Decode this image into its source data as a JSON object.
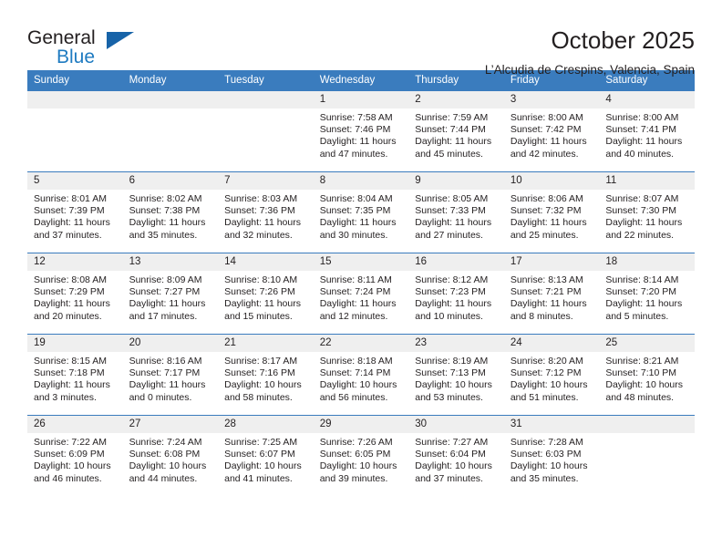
{
  "brand": {
    "name_part1": "General",
    "name_part2": "Blue",
    "accent_color": "#1763a8",
    "text_color": "#231f20"
  },
  "header": {
    "month_title": "October 2025",
    "location": "L’Alcudia de Crespins, Valencia, Spain"
  },
  "calendar": {
    "header_bg": "#3a7cbe",
    "daynum_bg": "#efefef",
    "weekday_headers": [
      "Sunday",
      "Monday",
      "Tuesday",
      "Wednesday",
      "Thursday",
      "Friday",
      "Saturday"
    ],
    "weeks": [
      [
        {
          "day": "",
          "empty": true,
          "sunrise": "",
          "sunset": "",
          "daylight_line1": "",
          "daylight_line2": ""
        },
        {
          "day": "",
          "empty": true,
          "sunrise": "",
          "sunset": "",
          "daylight_line1": "",
          "daylight_line2": ""
        },
        {
          "day": "",
          "empty": true,
          "sunrise": "",
          "sunset": "",
          "daylight_line1": "",
          "daylight_line2": ""
        },
        {
          "day": "1",
          "empty": false,
          "sunrise": "Sunrise: 7:58 AM",
          "sunset": "Sunset: 7:46 PM",
          "daylight_line1": "Daylight: 11 hours",
          "daylight_line2": "and 47 minutes."
        },
        {
          "day": "2",
          "empty": false,
          "sunrise": "Sunrise: 7:59 AM",
          "sunset": "Sunset: 7:44 PM",
          "daylight_line1": "Daylight: 11 hours",
          "daylight_line2": "and 45 minutes."
        },
        {
          "day": "3",
          "empty": false,
          "sunrise": "Sunrise: 8:00 AM",
          "sunset": "Sunset: 7:42 PM",
          "daylight_line1": "Daylight: 11 hours",
          "daylight_line2": "and 42 minutes."
        },
        {
          "day": "4",
          "empty": false,
          "sunrise": "Sunrise: 8:00 AM",
          "sunset": "Sunset: 7:41 PM",
          "daylight_line1": "Daylight: 11 hours",
          "daylight_line2": "and 40 minutes."
        }
      ],
      [
        {
          "day": "5",
          "empty": false,
          "sunrise": "Sunrise: 8:01 AM",
          "sunset": "Sunset: 7:39 PM",
          "daylight_line1": "Daylight: 11 hours",
          "daylight_line2": "and 37 minutes."
        },
        {
          "day": "6",
          "empty": false,
          "sunrise": "Sunrise: 8:02 AM",
          "sunset": "Sunset: 7:38 PM",
          "daylight_line1": "Daylight: 11 hours",
          "daylight_line2": "and 35 minutes."
        },
        {
          "day": "7",
          "empty": false,
          "sunrise": "Sunrise: 8:03 AM",
          "sunset": "Sunset: 7:36 PM",
          "daylight_line1": "Daylight: 11 hours",
          "daylight_line2": "and 32 minutes."
        },
        {
          "day": "8",
          "empty": false,
          "sunrise": "Sunrise: 8:04 AM",
          "sunset": "Sunset: 7:35 PM",
          "daylight_line1": "Daylight: 11 hours",
          "daylight_line2": "and 30 minutes."
        },
        {
          "day": "9",
          "empty": false,
          "sunrise": "Sunrise: 8:05 AM",
          "sunset": "Sunset: 7:33 PM",
          "daylight_line1": "Daylight: 11 hours",
          "daylight_line2": "and 27 minutes."
        },
        {
          "day": "10",
          "empty": false,
          "sunrise": "Sunrise: 8:06 AM",
          "sunset": "Sunset: 7:32 PM",
          "daylight_line1": "Daylight: 11 hours",
          "daylight_line2": "and 25 minutes."
        },
        {
          "day": "11",
          "empty": false,
          "sunrise": "Sunrise: 8:07 AM",
          "sunset": "Sunset: 7:30 PM",
          "daylight_line1": "Daylight: 11 hours",
          "daylight_line2": "and 22 minutes."
        }
      ],
      [
        {
          "day": "12",
          "empty": false,
          "sunrise": "Sunrise: 8:08 AM",
          "sunset": "Sunset: 7:29 PM",
          "daylight_line1": "Daylight: 11 hours",
          "daylight_line2": "and 20 minutes."
        },
        {
          "day": "13",
          "empty": false,
          "sunrise": "Sunrise: 8:09 AM",
          "sunset": "Sunset: 7:27 PM",
          "daylight_line1": "Daylight: 11 hours",
          "daylight_line2": "and 17 minutes."
        },
        {
          "day": "14",
          "empty": false,
          "sunrise": "Sunrise: 8:10 AM",
          "sunset": "Sunset: 7:26 PM",
          "daylight_line1": "Daylight: 11 hours",
          "daylight_line2": "and 15 minutes."
        },
        {
          "day": "15",
          "empty": false,
          "sunrise": "Sunrise: 8:11 AM",
          "sunset": "Sunset: 7:24 PM",
          "daylight_line1": "Daylight: 11 hours",
          "daylight_line2": "and 12 minutes."
        },
        {
          "day": "16",
          "empty": false,
          "sunrise": "Sunrise: 8:12 AM",
          "sunset": "Sunset: 7:23 PM",
          "daylight_line1": "Daylight: 11 hours",
          "daylight_line2": "and 10 minutes."
        },
        {
          "day": "17",
          "empty": false,
          "sunrise": "Sunrise: 8:13 AM",
          "sunset": "Sunset: 7:21 PM",
          "daylight_line1": "Daylight: 11 hours",
          "daylight_line2": "and 8 minutes."
        },
        {
          "day": "18",
          "empty": false,
          "sunrise": "Sunrise: 8:14 AM",
          "sunset": "Sunset: 7:20 PM",
          "daylight_line1": "Daylight: 11 hours",
          "daylight_line2": "and 5 minutes."
        }
      ],
      [
        {
          "day": "19",
          "empty": false,
          "sunrise": "Sunrise: 8:15 AM",
          "sunset": "Sunset: 7:18 PM",
          "daylight_line1": "Daylight: 11 hours",
          "daylight_line2": "and 3 minutes."
        },
        {
          "day": "20",
          "empty": false,
          "sunrise": "Sunrise: 8:16 AM",
          "sunset": "Sunset: 7:17 PM",
          "daylight_line1": "Daylight: 11 hours",
          "daylight_line2": "and 0 minutes."
        },
        {
          "day": "21",
          "empty": false,
          "sunrise": "Sunrise: 8:17 AM",
          "sunset": "Sunset: 7:16 PM",
          "daylight_line1": "Daylight: 10 hours",
          "daylight_line2": "and 58 minutes."
        },
        {
          "day": "22",
          "empty": false,
          "sunrise": "Sunrise: 8:18 AM",
          "sunset": "Sunset: 7:14 PM",
          "daylight_line1": "Daylight: 10 hours",
          "daylight_line2": "and 56 minutes."
        },
        {
          "day": "23",
          "empty": false,
          "sunrise": "Sunrise: 8:19 AM",
          "sunset": "Sunset: 7:13 PM",
          "daylight_line1": "Daylight: 10 hours",
          "daylight_line2": "and 53 minutes."
        },
        {
          "day": "24",
          "empty": false,
          "sunrise": "Sunrise: 8:20 AM",
          "sunset": "Sunset: 7:12 PM",
          "daylight_line1": "Daylight: 10 hours",
          "daylight_line2": "and 51 minutes."
        },
        {
          "day": "25",
          "empty": false,
          "sunrise": "Sunrise: 8:21 AM",
          "sunset": "Sunset: 7:10 PM",
          "daylight_line1": "Daylight: 10 hours",
          "daylight_line2": "and 48 minutes."
        }
      ],
      [
        {
          "day": "26",
          "empty": false,
          "sunrise": "Sunrise: 7:22 AM",
          "sunset": "Sunset: 6:09 PM",
          "daylight_line1": "Daylight: 10 hours",
          "daylight_line2": "and 46 minutes."
        },
        {
          "day": "27",
          "empty": false,
          "sunrise": "Sunrise: 7:24 AM",
          "sunset": "Sunset: 6:08 PM",
          "daylight_line1": "Daylight: 10 hours",
          "daylight_line2": "and 44 minutes."
        },
        {
          "day": "28",
          "empty": false,
          "sunrise": "Sunrise: 7:25 AM",
          "sunset": "Sunset: 6:07 PM",
          "daylight_line1": "Daylight: 10 hours",
          "daylight_line2": "and 41 minutes."
        },
        {
          "day": "29",
          "empty": false,
          "sunrise": "Sunrise: 7:26 AM",
          "sunset": "Sunset: 6:05 PM",
          "daylight_line1": "Daylight: 10 hours",
          "daylight_line2": "and 39 minutes."
        },
        {
          "day": "30",
          "empty": false,
          "sunrise": "Sunrise: 7:27 AM",
          "sunset": "Sunset: 6:04 PM",
          "daylight_line1": "Daylight: 10 hours",
          "daylight_line2": "and 37 minutes."
        },
        {
          "day": "31",
          "empty": false,
          "sunrise": "Sunrise: 7:28 AM",
          "sunset": "Sunset: 6:03 PM",
          "daylight_line1": "Daylight: 10 hours",
          "daylight_line2": "and 35 minutes."
        },
        {
          "day": "",
          "empty": true,
          "sunrise": "",
          "sunset": "",
          "daylight_line1": "",
          "daylight_line2": ""
        }
      ]
    ]
  }
}
